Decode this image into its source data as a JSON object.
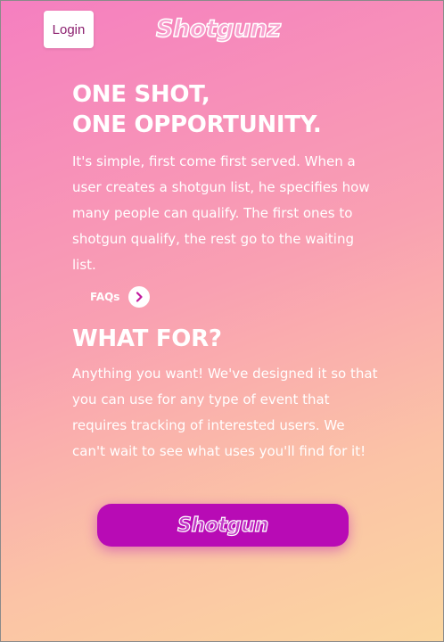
{
  "header": {
    "login_label": "Login",
    "logo_text": "Shotgunz"
  },
  "hero": {
    "title_line1": "ONE SHOT,",
    "title_line2": "ONE OPPORTUNITY.",
    "description": "It's simple, first come first served. When a user creates a shotgun list, he specifies how many people can qualify. The first ones to shotgun qualify, the rest go to the waiting list.",
    "faqs_label": "FAQs",
    "faqs_icon": "chevron-right-icon"
  },
  "what_for": {
    "title": "WHAT FOR?",
    "description": "Anything you want! We've designed it so that you can use for any type of event that requires tracking of interested users. We can't wait to see what uses you'll find for it!"
  },
  "cta": {
    "label": "Shotgun"
  },
  "colors": {
    "gradient_start": "#f57fc0",
    "gradient_end": "#fbd6a0",
    "button_purple": "#b80bb5",
    "login_text": "#8b1f6e"
  }
}
